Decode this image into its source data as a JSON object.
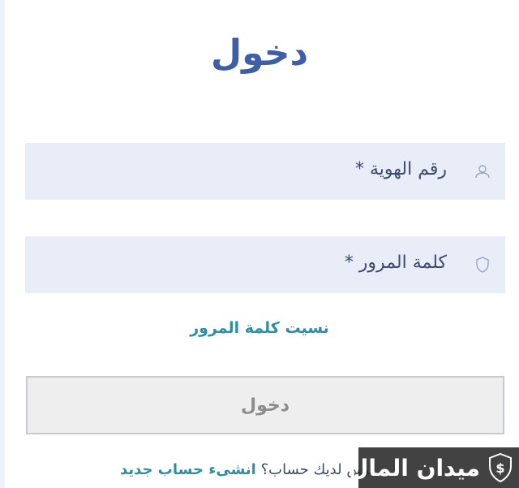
{
  "page": {
    "title": "دخول"
  },
  "fields": {
    "id_number": {
      "label": "رقم الهوية *",
      "icon": "user-icon"
    },
    "password": {
      "label": "كلمة المرور *",
      "icon": "shield-icon"
    }
  },
  "links": {
    "forgot_password": "نسيت كلمة المرور"
  },
  "buttons": {
    "login_label": "دخول"
  },
  "signup": {
    "prompt": "ليس لديك حساب؟",
    "link": "انشىء حساب جديد"
  },
  "watermark": {
    "text": "ميدان المال"
  },
  "colors": {
    "title": "#3f5ea8",
    "field_bg": "#e9edf7",
    "link": "#2d8fa3",
    "button_bg": "#eeeeee",
    "button_text": "#8c8c8c"
  }
}
